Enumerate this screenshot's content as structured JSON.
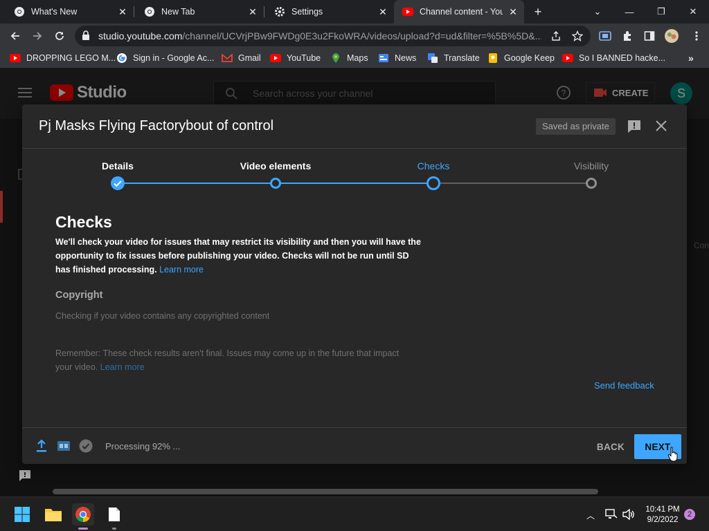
{
  "browser": {
    "tabs": [
      {
        "title": "What's New",
        "icon": "chrome-icon"
      },
      {
        "title": "New Tab",
        "icon": "chrome-icon"
      },
      {
        "title": "Settings",
        "icon": "gear-icon"
      },
      {
        "title": "Channel content - YouTube Studio",
        "icon": "youtube-icon",
        "active": true
      }
    ],
    "url_host": "studio.youtube.com",
    "url_path": "/channel/UCVrjPBw9FWDg0E3u2FkoWRA/videos/upload?d=ud&filter=%5B%5D&...",
    "bookmarks": [
      {
        "label": "DROPPING LEGO M...",
        "icon": "youtube-icon"
      },
      {
        "label": "Sign in - Google Ac...",
        "icon": "google-icon"
      },
      {
        "label": "Gmail",
        "icon": "gmail-icon"
      },
      {
        "label": "YouTube",
        "icon": "youtube-icon"
      },
      {
        "label": "Maps",
        "icon": "maps-icon"
      },
      {
        "label": "News",
        "icon": "news-icon"
      },
      {
        "label": "Translate",
        "icon": "translate-icon"
      },
      {
        "label": "Google Keep",
        "icon": "keep-icon"
      },
      {
        "label": "So I BANNED hacke...",
        "icon": "youtube-icon"
      }
    ]
  },
  "studio": {
    "logo_text": "Studio",
    "search_placeholder": "Search across your channel",
    "create_label": "CREATE",
    "avatar_letter": "S",
    "side_peek_text": "Con"
  },
  "dialog": {
    "title": "Pj Masks Flying Factorybout of control",
    "saved_chip": "Saved as private",
    "steps": [
      {
        "label": "Details",
        "state": "done"
      },
      {
        "label": "Video elements",
        "state": "done"
      },
      {
        "label": "Checks",
        "state": "active"
      },
      {
        "label": "Visibility",
        "state": "future"
      }
    ],
    "checks_heading": "Checks",
    "checks_text_1": "We'll check your video for issues that may restrict its visibility and then you will have the opportunity to fix issues before publishing your video.",
    "checks_text_2": "Checks will not be run until SD has finished processing.",
    "learn_more": "Learn more",
    "copyright_heading": "Copyright",
    "copyright_text": "Checking if your video contains any copyrighted content",
    "remember_text": "Remember: These check results aren't final. Issues may come up in the future that impact your video.",
    "remember_link": "Learn more",
    "send_feedback": "Send feedback",
    "processing_text": "Processing 92% ...",
    "back_label": "BACK",
    "next_label": "NEXT"
  },
  "taskbar": {
    "time": "10:41 PM",
    "date": "9/2/2022",
    "notification_count": "2"
  },
  "colors": {
    "accent": "#3ea6ff",
    "youtube_red": "#ff0000",
    "dialog_bg": "#282828"
  }
}
